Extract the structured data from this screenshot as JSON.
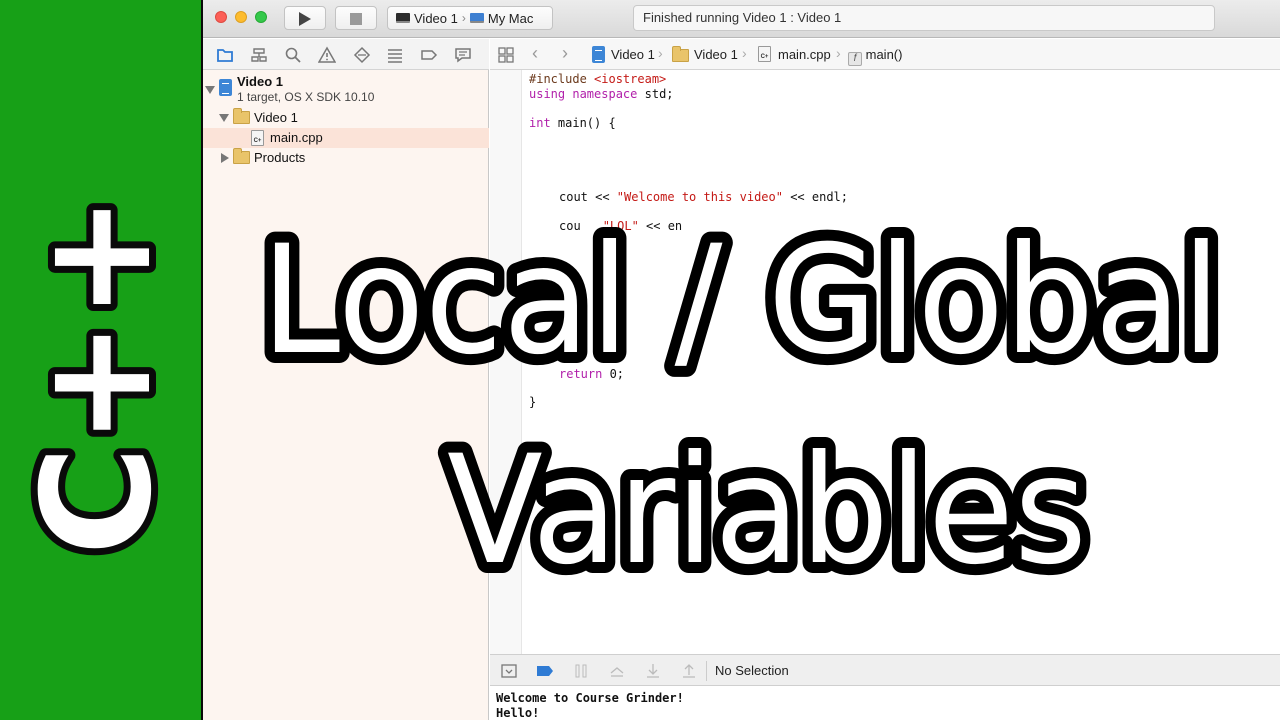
{
  "banner": {
    "text": "C++"
  },
  "toolbar": {
    "scheme_target": "Video 1",
    "scheme_device": "My Mac",
    "activity_status": "Finished running Video 1 : Video 1"
  },
  "navigator": {
    "project_name": "Video 1",
    "project_subtitle": "1 target, OS X SDK 10.10",
    "group_name": "Video 1",
    "file_name": "main.cpp",
    "file_badge": "C+",
    "products_name": "Products"
  },
  "jumpbar": {
    "crumbs": [
      "Video 1",
      "Video 1",
      "main.cpp",
      "main()"
    ],
    "func_badge": "f"
  },
  "code": {
    "line1_a": "#include ",
    "line1_b": "<iostream>",
    "line2_kw1": "using",
    "line2_kw2": "namespace",
    "line2_rest": " std;",
    "line3_kw": "int",
    "line3_rest": " main() {",
    "line4_a": "cout << ",
    "line4_str": "\"Welcome to this video\"",
    "line4_b": " << endl;",
    "line5_a": "cou",
    "line5_str": "\"LOL\"",
    "line5_b": " << en",
    "line6_kw": "return",
    "line6_rest": " 0;",
    "line7": "}"
  },
  "debug": {
    "status": "No Selection"
  },
  "console": {
    "lines": [
      "Welcome to Course Grinder!",
      "Hello!"
    ]
  },
  "overlay": {
    "line1": "Local / Global",
    "line2": "Variables"
  },
  "colors": {
    "banner_green": "#17a017",
    "navigator_bg": "#fdf5f0",
    "keyword": "#b11faa",
    "string": "#c41a16"
  }
}
